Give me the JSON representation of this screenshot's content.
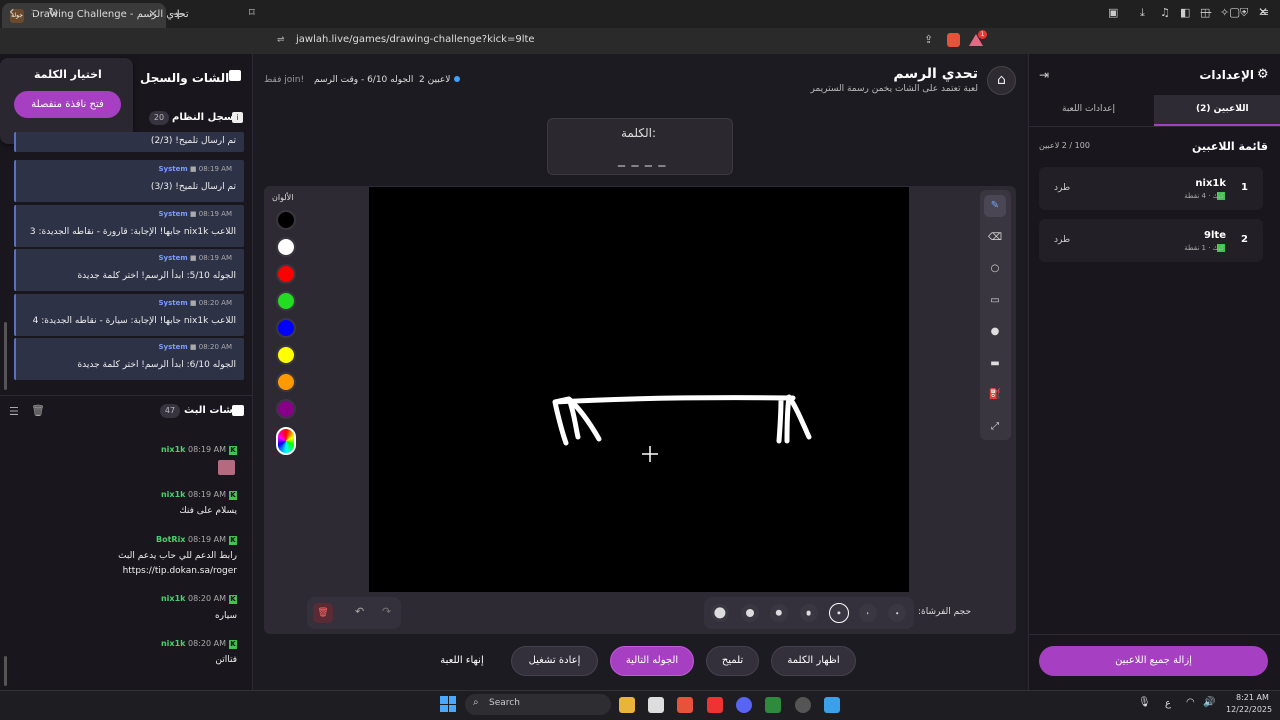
{
  "browser": {
    "tab_title": "Drawing Challenge - تحدي الرسم",
    "tab_icon_text": "جولة",
    "url": "jawlah.live/games/drawing-challenge?kick=9lte",
    "ext_badge": "1"
  },
  "header": {
    "title": "تحدي الرسم",
    "subtitle": "لعبة تعتمد على الشات يخمن رسمة الستريمر",
    "status_players": "2 لاعبين",
    "status_round": "الجوله 6/10 - وقت الرسم",
    "status_join": "!join فقط"
  },
  "word_box": {
    "label": "الكلمة:",
    "mask": "_ _ _ _"
  },
  "colors": {
    "label": "الألوان",
    "swatches": [
      "#000000",
      "#ffffff",
      "#ff0000",
      "#22dd22",
      "#0000ff",
      "#ffff00",
      "#ff9900",
      "#880088"
    ]
  },
  "tools": [
    "pencil-icon",
    "eraser-icon",
    "circle-icon",
    "rectangle-icon",
    "filled-circle-icon",
    "filled-rect-icon",
    "fill-bucket-icon",
    "line-icon"
  ],
  "bottom_controls": {
    "brush_label": "حجم الفرشاة:",
    "brush_sizes": [
      7,
      5,
      4,
      3,
      2,
      1,
      1
    ]
  },
  "actions": {
    "show_word": "اظهار الكلمة",
    "hint": "تلميح",
    "next_round": "الجوله التالية",
    "restart": "إعادة تشغيل",
    "end_game": "إنهاء اللعبة"
  },
  "left": {
    "title": "الشات والسجل",
    "popup_title": "اختيار الكلمة",
    "popup_button": "فتح نافذة منفصلة",
    "log_title": "سجل النظام",
    "log_count": "20",
    "log": [
      {
        "time": "",
        "text": "تم ارسال تلميح! (2/3)"
      },
      {
        "time": "08:19 AM",
        "text": "تم ارسال تلميح! (3/3)"
      },
      {
        "time": "08:19 AM",
        "text": "اللاعب nix1k جابها! الإجابة: قارورة - نقاطه الجديدة: 3"
      },
      {
        "time": "08:19 AM",
        "text": "الجوله 5/10: ابدأ الرسم! اختر كلمة جديدة"
      },
      {
        "time": "08:20 AM",
        "text": "اللاعب nix1k جابها! الإجابة: سيارة - نقاطه الجديدة: 4"
      },
      {
        "time": "08:20 AM",
        "text": "الجوله 6/10: ابدأ الرسم! اختر كلمة جديدة"
      }
    ],
    "log_sender": "System",
    "stream_title": "شات البث",
    "stream_count": "47",
    "chat": [
      {
        "user": "nix1k",
        "time": "08:19 AM",
        "text": ""
      },
      {
        "user": "nix1k",
        "time": "08:19 AM",
        "text": "يسلام على فنك"
      },
      {
        "user": "BotRix",
        "time": "08:19 AM",
        "text": "رابط الدعم للي حاب يدعم البث",
        "text2": "https://tip.dokan.sa/roger"
      },
      {
        "user": "nix1k",
        "time": "08:20 AM",
        "text": "سياره"
      },
      {
        "user": "nix1k",
        "time": "08:20 AM",
        "text": "فتااتن"
      }
    ]
  },
  "right": {
    "title": "الإعدادات",
    "tab_players": "اللاعبين (2)",
    "tab_settings": "إعدادات اللعبة",
    "list_title": "قائمة اللاعبين",
    "list_count": "100 / 2 لاعبين",
    "players": [
      {
        "rank": "1",
        "name": "nix1k",
        "meta": "كيك · 4 نقطة",
        "kick": "طرد"
      },
      {
        "rank": "2",
        "name": "9lte",
        "meta": "كيك · 1 نقطة",
        "kick": "طرد"
      }
    ],
    "remove_all": "إزالة جميع اللاعبين"
  },
  "taskbar": {
    "search": "Search",
    "time": "8:21 AM",
    "date": "12/22/2025",
    "lang": "ع"
  }
}
